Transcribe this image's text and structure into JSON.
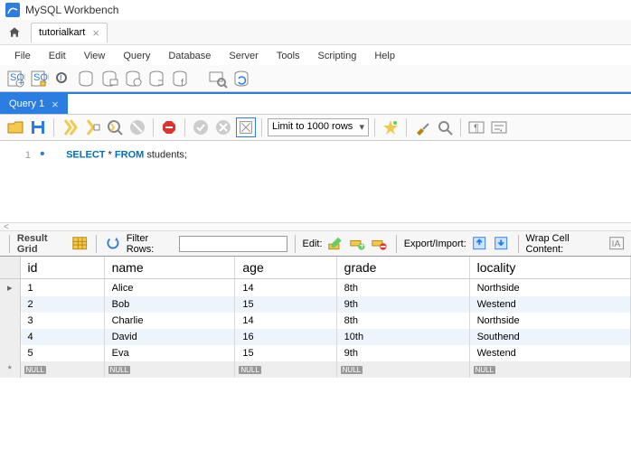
{
  "title": "MySQL Workbench",
  "doc_tab": {
    "label": "tutorialkart"
  },
  "menu": [
    "File",
    "Edit",
    "View",
    "Query",
    "Database",
    "Server",
    "Tools",
    "Scripting",
    "Help"
  ],
  "query_tab": {
    "label": "Query 1"
  },
  "query_toolbar": {
    "limit_label": "Limit to 1000 rows"
  },
  "editor": {
    "line_no": "1",
    "kw_select": "SELECT",
    "star": " * ",
    "kw_from": "FROM",
    "rest": " students;"
  },
  "result_toolbar": {
    "result_grid": "Result Grid",
    "filter_label": "Filter Rows:",
    "edit_label": "Edit:",
    "export_label": "Export/Import:",
    "wrap_label": "Wrap Cell Content:"
  },
  "grid": {
    "columns": [
      "id",
      "name",
      "age",
      "grade",
      "locality"
    ],
    "rows": [
      {
        "id": "1",
        "name": "Alice",
        "age": "14",
        "grade": "8th",
        "locality": "Northside"
      },
      {
        "id": "2",
        "name": "Bob",
        "age": "15",
        "grade": "9th",
        "locality": "Westend"
      },
      {
        "id": "3",
        "name": "Charlie",
        "age": "14",
        "grade": "8th",
        "locality": "Northside"
      },
      {
        "id": "4",
        "name": "David",
        "age": "16",
        "grade": "10th",
        "locality": "Southend"
      },
      {
        "id": "5",
        "name": "Eva",
        "age": "15",
        "grade": "9th",
        "locality": "Westend"
      }
    ],
    "null_label": "NULL"
  }
}
